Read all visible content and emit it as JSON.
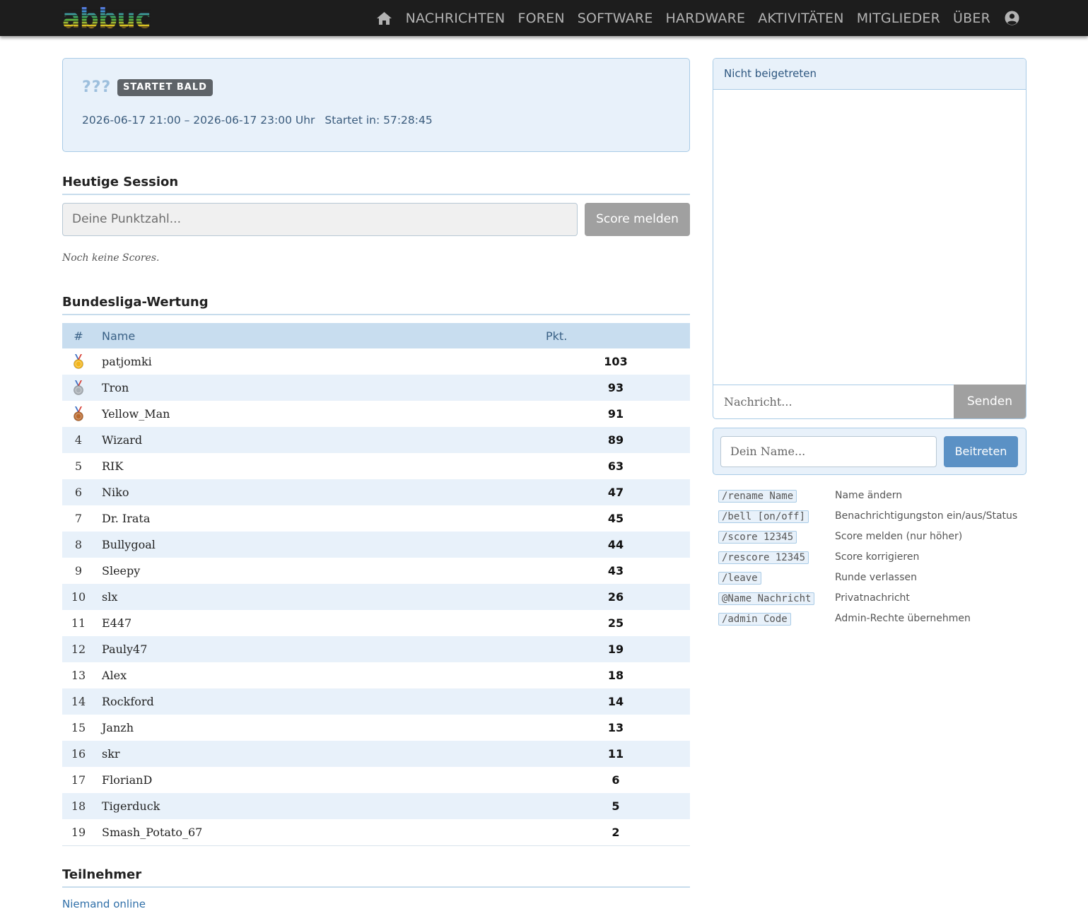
{
  "nav": {
    "logo_text": "abbuc",
    "items": [
      "NACHRICHTEN",
      "FOREN",
      "SOFTWARE",
      "HARDWARE",
      "AKTIVITÄTEN",
      "MITGLIEDER",
      "ÜBER"
    ],
    "icons": [
      "home-icon",
      "user-circle-icon"
    ]
  },
  "event": {
    "title": "???",
    "badge": "STARTET BALD",
    "time_range": "2026-06-17 21:00 – 2026-06-17 23:00 Uhr",
    "countdown": "Startet in: 57:28:45"
  },
  "session": {
    "heading": "Heutige Session",
    "input_placeholder": "Deine Punktzahl...",
    "button_label": "Score melden",
    "empty_text": "Noch keine Scores."
  },
  "league": {
    "heading": "Bundesliga-Wertung",
    "columns": [
      "#",
      "Name",
      "Pkt."
    ],
    "rows": [
      {
        "rank": "",
        "medal": "gold",
        "name": "patjomki",
        "points": "103"
      },
      {
        "rank": "",
        "medal": "silver",
        "name": "Tron",
        "points": "93"
      },
      {
        "rank": "",
        "medal": "bronze",
        "name": "Yellow_Man",
        "points": "91"
      },
      {
        "rank": "4",
        "medal": "",
        "name": "Wizard",
        "points": "89"
      },
      {
        "rank": "5",
        "medal": "",
        "name": "RIK",
        "points": "63"
      },
      {
        "rank": "6",
        "medal": "",
        "name": "Niko",
        "points": "47"
      },
      {
        "rank": "7",
        "medal": "",
        "name": "Dr. Irata",
        "points": "45"
      },
      {
        "rank": "8",
        "medal": "",
        "name": "Bullygoal",
        "points": "44"
      },
      {
        "rank": "9",
        "medal": "",
        "name": "Sleepy",
        "points": "43"
      },
      {
        "rank": "10",
        "medal": "",
        "name": "slx",
        "points": "26"
      },
      {
        "rank": "11",
        "medal": "",
        "name": "E447",
        "points": "25"
      },
      {
        "rank": "12",
        "medal": "",
        "name": "Pauly47",
        "points": "19"
      },
      {
        "rank": "13",
        "medal": "",
        "name": "Alex",
        "points": "18"
      },
      {
        "rank": "14",
        "medal": "",
        "name": "Rockford",
        "points": "14"
      },
      {
        "rank": "15",
        "medal": "",
        "name": "Janzh",
        "points": "13"
      },
      {
        "rank": "16",
        "medal": "",
        "name": "skr",
        "points": "11"
      },
      {
        "rank": "17",
        "medal": "",
        "name": "FlorianD",
        "points": "6"
      },
      {
        "rank": "18",
        "medal": "",
        "name": "Tigerduck",
        "points": "5"
      },
      {
        "rank": "19",
        "medal": "",
        "name": "Smash_Potato_67",
        "points": "2"
      }
    ]
  },
  "participants": {
    "heading": "Teilnehmer",
    "empty_text": "Niemand online"
  },
  "chat": {
    "header": "Nicht beigetreten",
    "input_placeholder": "Nachricht...",
    "send_label": "Senden"
  },
  "join": {
    "input_placeholder": "Dein Name...",
    "button_label": "Beitreten"
  },
  "commands": [
    {
      "code": "/rename Name",
      "desc": "Name ändern"
    },
    {
      "code": "/bell [on/off]",
      "desc": "Benachrichtigungston ein/aus/Status"
    },
    {
      "code": "/score 12345",
      "desc": "Score melden (nur höher)"
    },
    {
      "code": "/rescore 12345",
      "desc": "Score korrigieren"
    },
    {
      "code": "/leave",
      "desc": "Runde verlassen"
    },
    {
      "code": "@Name Nachricht",
      "desc": "Privatnachricht"
    },
    {
      "code": "/admin Code",
      "desc": "Admin-Rechte übernehmen"
    }
  ],
  "colors": {
    "navbar": "#1d1d1d",
    "panel_bg": "#e8f1fa",
    "panel_border": "#a9cbe6",
    "primary_button": "#5b91c5",
    "disabled_button": "#a0a0a0",
    "medal_gold": "#f2b51c",
    "medal_silver": "#a8aeb4",
    "medal_bronze": "#b9692e"
  }
}
